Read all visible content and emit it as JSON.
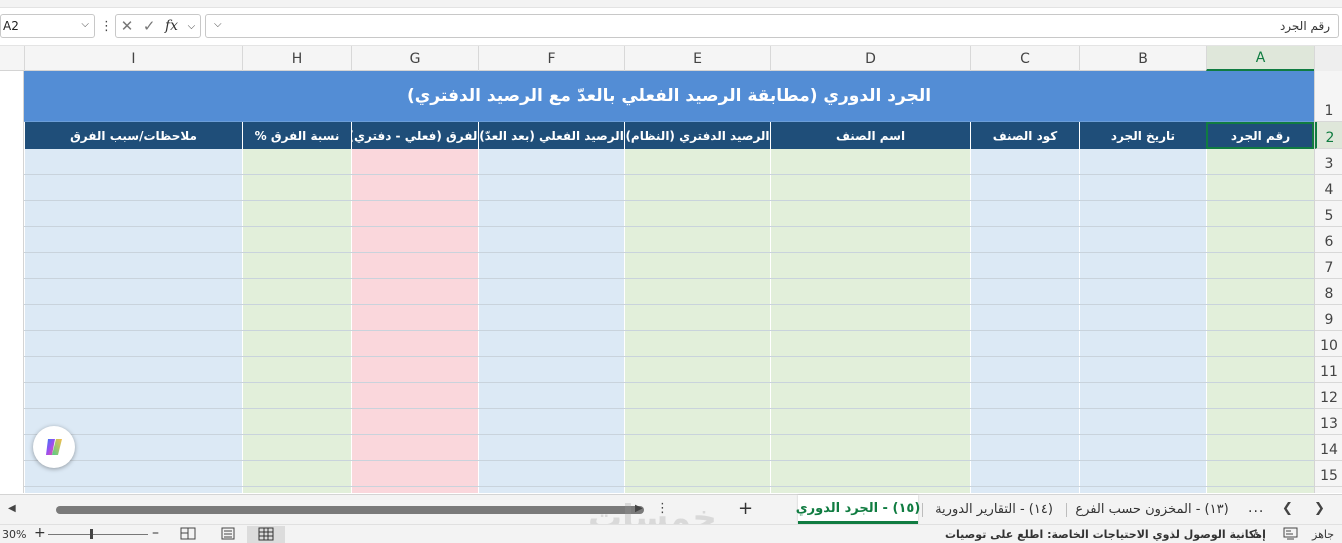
{
  "formula_bar": {
    "name_box": "A2",
    "fx_label": "fx",
    "formula_value": "رقم الجرد"
  },
  "column_headers": [
    "I",
    "H",
    "G",
    "F",
    "E",
    "D",
    "C",
    "B",
    "A"
  ],
  "row_headers": [
    "1",
    "2",
    "3",
    "4",
    "5",
    "6",
    "7",
    "8",
    "9",
    "10",
    "11",
    "12",
    "13",
    "14",
    "15"
  ],
  "sheet": {
    "title": "الجرد الدوري (مطابقة الرصيد الفعلي بالعدّ مع الرصيد الدفتري)",
    "table_headers": {
      "A": "رقم الجرد",
      "B": "تاريخ الجرد",
      "C": "كود الصنف",
      "D": "اسم الصنف",
      "E": "الرصيد الدفتري (النظام)",
      "F": "الرصيد الفعلي (بعد العدّ)",
      "G": "الفرق (فعلي - دفتري)",
      "H": "نسبة الفرق %",
      "I": "ملاحظات/سبب الفرق"
    }
  },
  "tabs": [
    {
      "label": "(١٥) - الجرد الدوري",
      "active": true
    },
    {
      "label": "(١٤) - التقارير الدورية",
      "active": false
    },
    {
      "label": "(١٣) - المخزون حسب الفرع",
      "active": false
    }
  ],
  "tab_more": "...",
  "status_bar": {
    "zoom": "30%",
    "accessibility": "إمكانية الوصول لذوي الاحتياجات الخاصة: اطلع على توصيات",
    "ready": "جاهز"
  },
  "watermark": "خمسات",
  "colors": {
    "title_bg": "#538dd5",
    "header_bg": "#1f4e79",
    "blue_fill": "#dce9f5",
    "green_fill": "#e2efda",
    "pink_fill": "#fad7dc",
    "excel_green": "#107c41"
  }
}
